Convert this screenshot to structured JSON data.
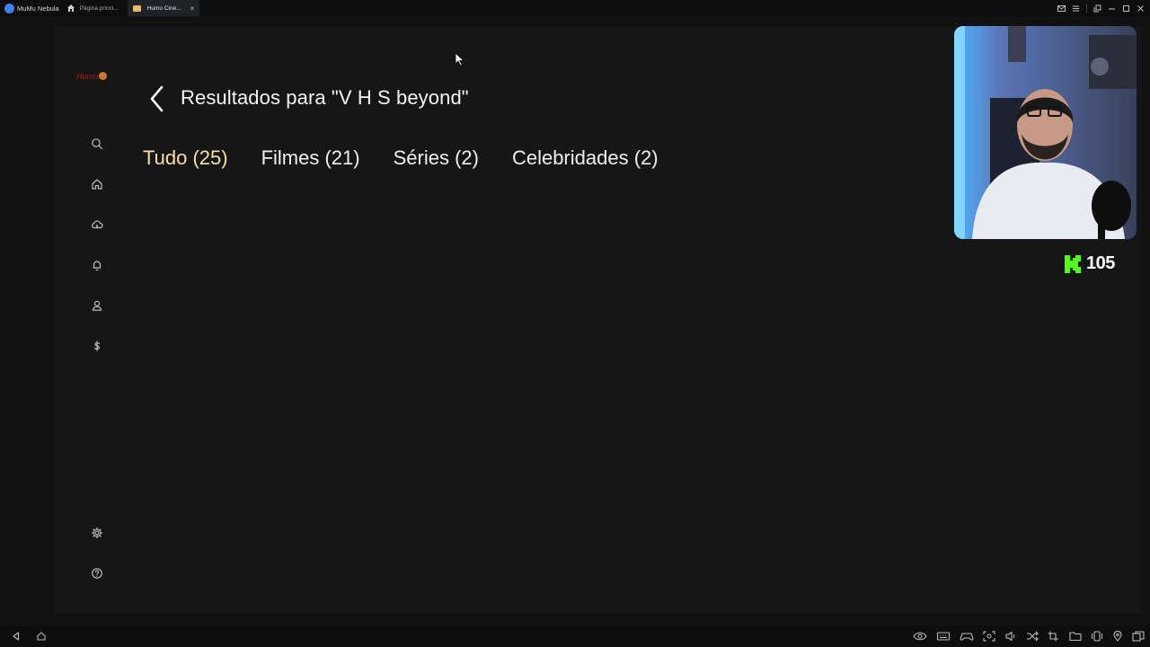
{
  "titlebar": {
    "app_name": "MuMu Nebula",
    "tabs": [
      {
        "label": "Página princi...",
        "icon": "home-icon",
        "active": false
      },
      {
        "label": "Humo Cine...",
        "icon": "app-favicon",
        "active": true,
        "close": "×"
      }
    ],
    "window_controls": [
      "mail-icon",
      "menu-icon",
      "restore-icon",
      "minimize-icon",
      "maximize-icon",
      "close-icon"
    ]
  },
  "app": {
    "logo_text": "Humo",
    "sidebar_icons": [
      "search-icon",
      "home-icon",
      "cloud-icon",
      "bell-icon",
      "user-icon",
      "dollar-icon",
      "settings-icon",
      "help-icon"
    ],
    "title": "Resultados para \"V H S beyond\"",
    "filter_tabs": [
      {
        "label": "Tudo (25)",
        "active": true
      },
      {
        "label": "Filmes (21)",
        "active": false
      },
      {
        "label": "Séries (2)",
        "active": false
      },
      {
        "label": "Celebridades (2)",
        "active": false
      }
    ],
    "accent_color": "#f5e1a4"
  },
  "overlay": {
    "kick_viewers": "105",
    "kick_color": "#53fc18"
  },
  "bottombar": {
    "left_icons": [
      "back-icon",
      "home-icon"
    ],
    "right_icons": [
      "eye-icon",
      "keyboard-icon",
      "gamepad-icon",
      "screenshot-icon",
      "volume-icon",
      "shuffle-icon",
      "crop-icon",
      "folder-icon",
      "shake-icon",
      "location-icon",
      "multi-window-icon"
    ]
  }
}
